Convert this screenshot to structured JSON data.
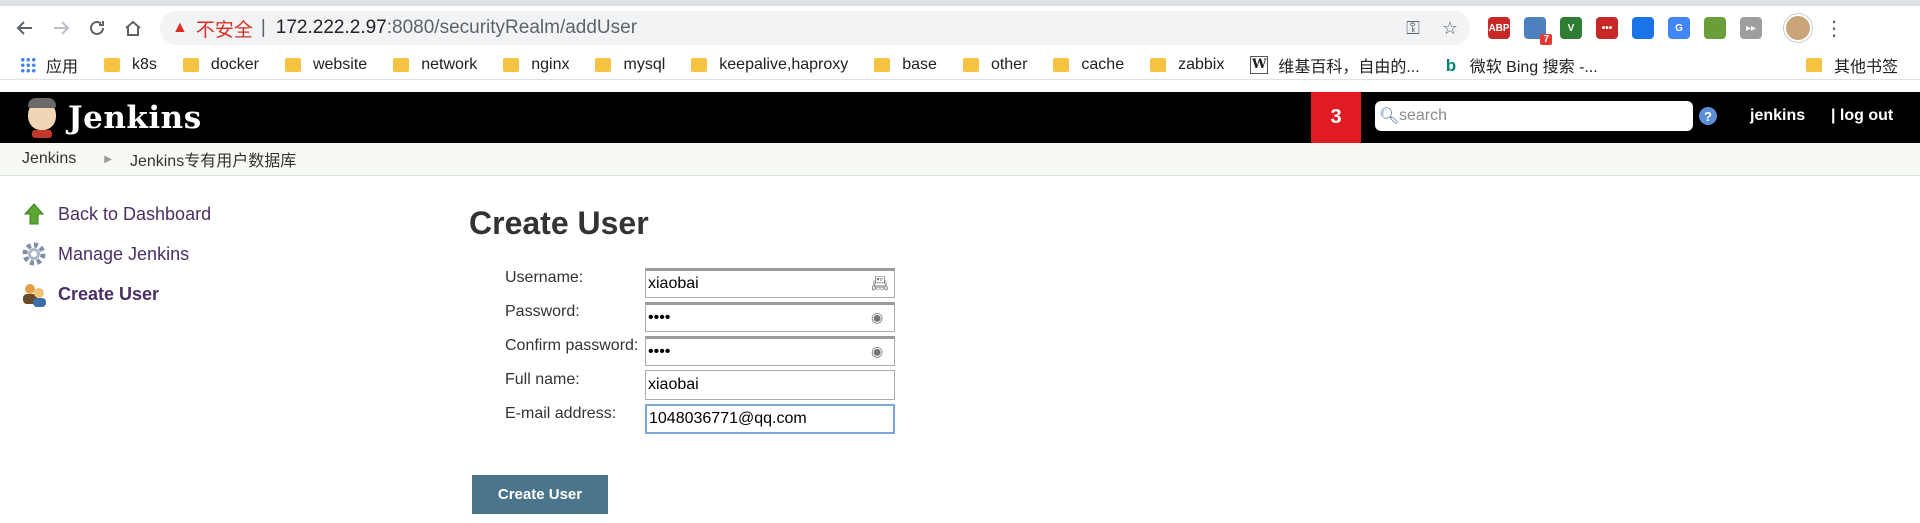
{
  "browser": {
    "url_warning": "不安全",
    "url_host": "172.222.2.97",
    "url_rest": ":8080/securityRealm/addUser",
    "extensions": [
      {
        "name": "abp",
        "label": "ABP",
        "color": "#c62828"
      },
      {
        "name": "ext2",
        "label": "",
        "color": "#4e7fbf",
        "badge": "7"
      },
      {
        "name": "ext3",
        "label": "V",
        "color": "#2e7d32"
      },
      {
        "name": "ext4",
        "label": "•••",
        "color": "#c62828"
      },
      {
        "name": "ext5",
        "label": "",
        "color": "#1a73e8"
      },
      {
        "name": "translate",
        "label": "G",
        "color": "#4285f4"
      },
      {
        "name": "ext7",
        "label": "",
        "color": "#689f38"
      },
      {
        "name": "ext8",
        "label": "▸▸",
        "color": "#9e9e9e"
      }
    ]
  },
  "bookmarks": {
    "apps": "应用",
    "folders": [
      "k8s",
      "docker",
      "website",
      "network",
      "nginx",
      "mysql",
      "keepalive,haproxy",
      "base",
      "other",
      "cache",
      "zabbix"
    ],
    "wiki": "维基百科，自由的...",
    "bing": "微软 Bing 搜索 -...",
    "other": "其他书签"
  },
  "header": {
    "title": "Jenkins",
    "notifications": "3",
    "search_placeholder": "search",
    "help": "?",
    "user": "jenkins",
    "logout": "| log out"
  },
  "breadcrumb": {
    "root": "Jenkins",
    "current": "Jenkins专有用户数据库"
  },
  "sidebar": {
    "items": [
      {
        "label": "Back to Dashboard"
      },
      {
        "label": "Manage Jenkins"
      },
      {
        "label": "Create User"
      }
    ]
  },
  "form": {
    "title": "Create User",
    "username_label": "Username:",
    "username_value": "xiaobai",
    "password_label": "Password:",
    "password_value": "1234",
    "confirm_label": "Confirm password:",
    "confirm_value": "1234",
    "fullname_label": "Full name:",
    "fullname_value": "xiaobai",
    "email_label": "E-mail address:",
    "email_value": "1048036771@qq.com",
    "submit": "Create User"
  }
}
